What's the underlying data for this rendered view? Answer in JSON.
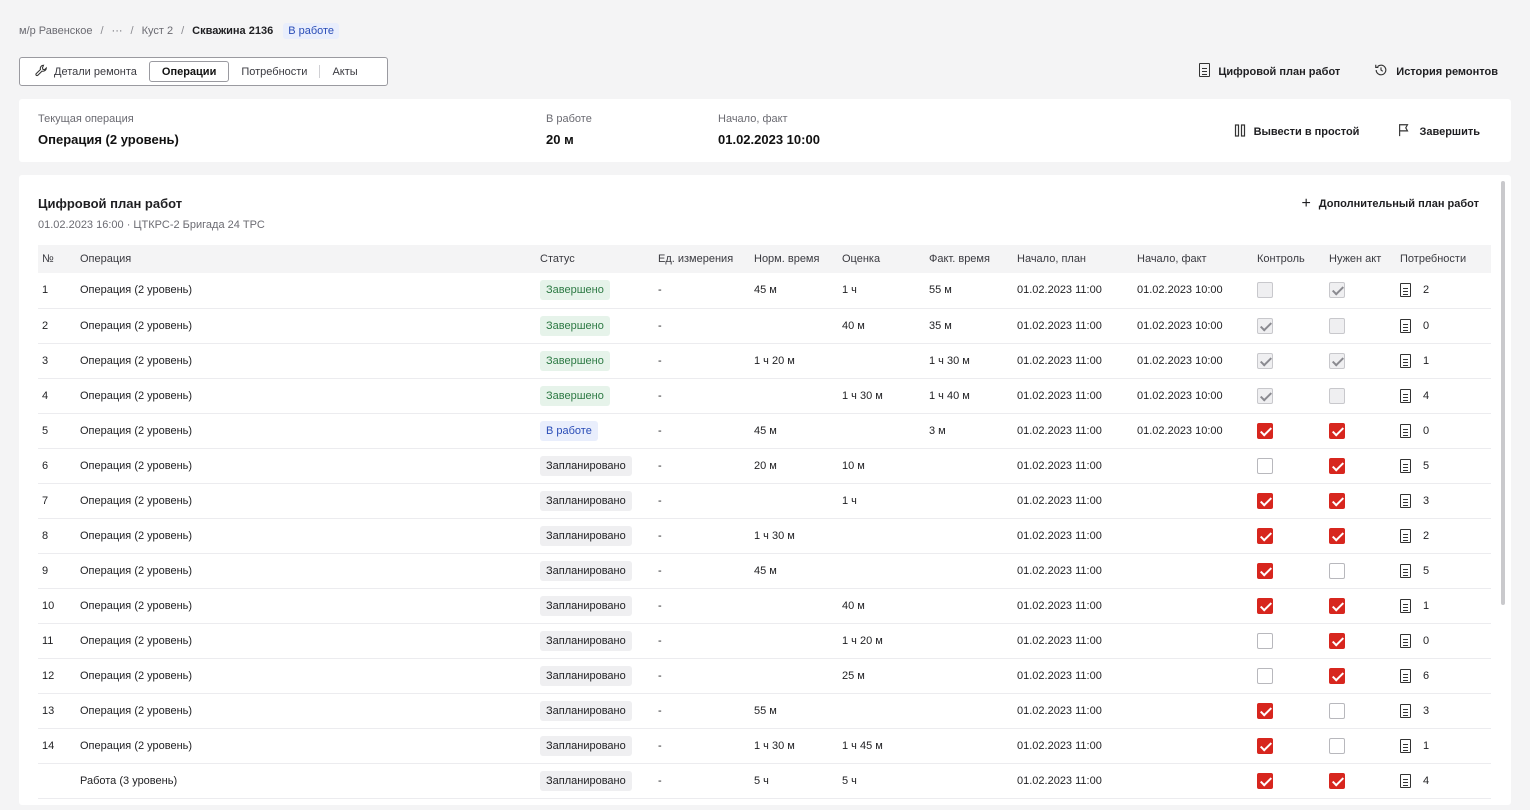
{
  "breadcrumb": {
    "items": [
      "м/р Равенское",
      "···",
      "Куст 2"
    ],
    "current": "Скважина 2136",
    "badge": "В работе"
  },
  "tabs": [
    {
      "label": "Детали ремонта",
      "icon": "wrench-icon"
    },
    {
      "label": "Операции",
      "active": true
    },
    {
      "label": "Потребности"
    },
    {
      "label": "Акты"
    }
  ],
  "top_actions": {
    "digital_plan": "Цифровой план работ",
    "history": "История ремонтов"
  },
  "current_op": {
    "label1": "Текущая операция",
    "value1": "Операция (2 уровень)",
    "label2": "В работе",
    "value2": "20 м",
    "label3": "Начало, факт",
    "value3": "01.02.2023 10:00",
    "btn_idle": "Вывести в простой",
    "btn_finish": "Завершить"
  },
  "plan": {
    "title": "Цифровой план работ",
    "subtitle": "01.02.2023 16:00 · ЦТКРС-2 Бригада 24 ТРС",
    "add_button": "Дополнительный план работ",
    "columns": [
      "№",
      "Операция",
      "Статус",
      "Ед. измерения",
      "Норм. время",
      "Оценка",
      "Факт. время",
      "Начало, план",
      "Начало, факт",
      "Контроль",
      "Нужен акт",
      "Потребности"
    ],
    "rows": [
      {
        "n": "1",
        "op": "Операция (2 уровень)",
        "status": "Завершено",
        "stype": "done",
        "unit": "-",
        "norm": "45 м",
        "est": "1 ч",
        "fact": "55 м",
        "plan_start": "01.02.2023 11:00",
        "fact_start": "01.02.2023 10:00",
        "ctrl": false,
        "act": true,
        "dis": true,
        "needs": "2"
      },
      {
        "n": "2",
        "op": "Операция (2 уровень)",
        "status": "Завершено",
        "stype": "done",
        "unit": "-",
        "norm": "",
        "est": "40 м",
        "fact": "35 м",
        "plan_start": "01.02.2023 11:00",
        "fact_start": "01.02.2023 10:00",
        "ctrl": true,
        "act": false,
        "dis": true,
        "needs": "0"
      },
      {
        "n": "3",
        "op": "Операция (2 уровень)",
        "status": "Завершено",
        "stype": "done",
        "unit": "-",
        "norm": "1 ч 20 м",
        "est": "",
        "fact": "1 ч 30 м",
        "plan_start": "01.02.2023 11:00",
        "fact_start": "01.02.2023 10:00",
        "ctrl": true,
        "act": true,
        "dis": true,
        "needs": "1"
      },
      {
        "n": "4",
        "op": "Операция (2 уровень)",
        "status": "Завершено",
        "stype": "done",
        "unit": "-",
        "norm": "",
        "est": "1 ч 30 м",
        "fact": "1 ч 40 м",
        "plan_start": "01.02.2023 11:00",
        "fact_start": "01.02.2023 10:00",
        "ctrl": true,
        "act": false,
        "dis": true,
        "needs": "4"
      },
      {
        "n": "5",
        "op": "Операция (2 уровень)",
        "status": "В работе",
        "stype": "work",
        "unit": "-",
        "norm": "45 м",
        "est": "",
        "fact": "3 м",
        "plan_start": "01.02.2023 11:00",
        "fact_start": "01.02.2023 10:00",
        "ctrl": true,
        "act": true,
        "dis": false,
        "needs": "0"
      },
      {
        "n": "6",
        "op": "Операция (2 уровень)",
        "status": "Запланировано",
        "stype": "plan",
        "unit": "-",
        "norm": "20 м",
        "est": "10 м",
        "fact": "",
        "plan_start": "01.02.2023 11:00",
        "fact_start": "",
        "ctrl": false,
        "act": true,
        "dis": false,
        "needs": "5"
      },
      {
        "n": "7",
        "op": "Операция (2 уровень)",
        "status": "Запланировано",
        "stype": "plan",
        "unit": "-",
        "norm": "",
        "est": "1 ч",
        "fact": "",
        "plan_start": "01.02.2023 11:00",
        "fact_start": "",
        "ctrl": true,
        "act": true,
        "dis": false,
        "needs": "3"
      },
      {
        "n": "8",
        "op": "Операция (2 уровень)",
        "status": "Запланировано",
        "stype": "plan",
        "unit": "-",
        "norm": "1 ч 30 м",
        "est": "",
        "fact": "",
        "plan_start": "01.02.2023 11:00",
        "fact_start": "",
        "ctrl": true,
        "act": true,
        "dis": false,
        "needs": "2"
      },
      {
        "n": "9",
        "op": "Операция (2 уровень)",
        "status": "Запланировано",
        "stype": "plan",
        "unit": "-",
        "norm": "45 м",
        "est": "",
        "fact": "",
        "plan_start": "01.02.2023 11:00",
        "fact_start": "",
        "ctrl": true,
        "act": false,
        "dis": false,
        "needs": "5"
      },
      {
        "n": "10",
        "op": "Операция (2 уровень)",
        "status": "Запланировано",
        "stype": "plan",
        "unit": "-",
        "norm": "",
        "est": "40 м",
        "fact": "",
        "plan_start": "01.02.2023 11:00",
        "fact_start": "",
        "ctrl": true,
        "act": true,
        "dis": false,
        "needs": "1"
      },
      {
        "n": "11",
        "op": "Операция (2 уровень)",
        "status": "Запланировано",
        "stype": "plan",
        "unit": "-",
        "norm": "",
        "est": "1 ч 20 м",
        "fact": "",
        "plan_start": "01.02.2023 11:00",
        "fact_start": "",
        "ctrl": false,
        "act": true,
        "dis": false,
        "needs": "0"
      },
      {
        "n": "12",
        "op": "Операция (2 уровень)",
        "status": "Запланировано",
        "stype": "plan",
        "unit": "-",
        "norm": "",
        "est": "25 м",
        "fact": "",
        "plan_start": "01.02.2023 11:00",
        "fact_start": "",
        "ctrl": false,
        "act": true,
        "dis": false,
        "needs": "6"
      },
      {
        "n": "13",
        "op": "Операция (2 уровень)",
        "status": "Запланировано",
        "stype": "plan",
        "unit": "-",
        "norm": "55 м",
        "est": "",
        "fact": "",
        "plan_start": "01.02.2023 11:00",
        "fact_start": "",
        "ctrl": true,
        "act": false,
        "dis": false,
        "needs": "3"
      },
      {
        "n": "14",
        "op": "Операция (2 уровень)",
        "status": "Запланировано",
        "stype": "plan",
        "unit": "-",
        "norm": "1 ч 30 м",
        "est": "1 ч 45 м",
        "fact": "",
        "plan_start": "01.02.2023 11:00",
        "fact_start": "",
        "ctrl": true,
        "act": false,
        "dis": false,
        "needs": "1"
      },
      {
        "n": "",
        "op": "Работа (3 уровень)",
        "status": "Запланировано",
        "stype": "plan",
        "unit": "-",
        "norm": "5 ч",
        "est": "5 ч",
        "fact": "",
        "plan_start": "01.02.2023 11:00",
        "fact_start": "",
        "ctrl": true,
        "act": true,
        "dis": false,
        "needs": "4"
      }
    ]
  }
}
